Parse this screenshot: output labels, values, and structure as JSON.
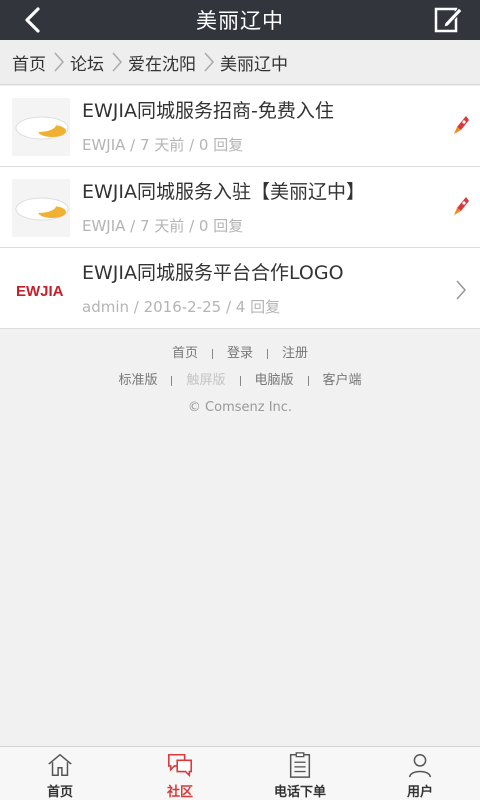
{
  "header": {
    "title": "美丽辽中",
    "back_icon": "back-arrow-icon",
    "edit_icon": "compose-icon"
  },
  "breadcrumb": [
    "首页",
    "论坛",
    "爱在沈阳",
    "美丽辽中"
  ],
  "threads": [
    {
      "title": "EWJIA同城服务招商-免费入住",
      "meta": "EWJIA / 7 天前 / 0 回复",
      "marker": "hot-rocket-icon"
    },
    {
      "title": "EWJIA同城服务入驻【美丽辽中】",
      "meta": "EWJIA / 7 天前 / 0 回复",
      "marker": "hot-rocket-icon"
    },
    {
      "title": "EWJIA同城服务平台合作LOGO",
      "meta": "admin / 2016-2-25 / 4 回复",
      "marker": "chevron-right-icon",
      "thumb_text": "EWJIA"
    }
  ],
  "footer": {
    "links1": [
      "首页",
      "登录",
      "注册"
    ],
    "links2": [
      "标准版",
      "触屏版",
      "电脑版",
      "客户端"
    ],
    "copyright": "© Comsenz Inc."
  },
  "tabs": [
    {
      "label": "首页",
      "icon": "home-icon"
    },
    {
      "label": "社区",
      "icon": "chat-bubbles-icon",
      "active": true
    },
    {
      "label": "电话下单",
      "icon": "clipboard-icon"
    },
    {
      "label": "用户",
      "icon": "user-icon"
    }
  ],
  "colors": {
    "topbar": "#32363c",
    "accent": "#d9393a"
  }
}
